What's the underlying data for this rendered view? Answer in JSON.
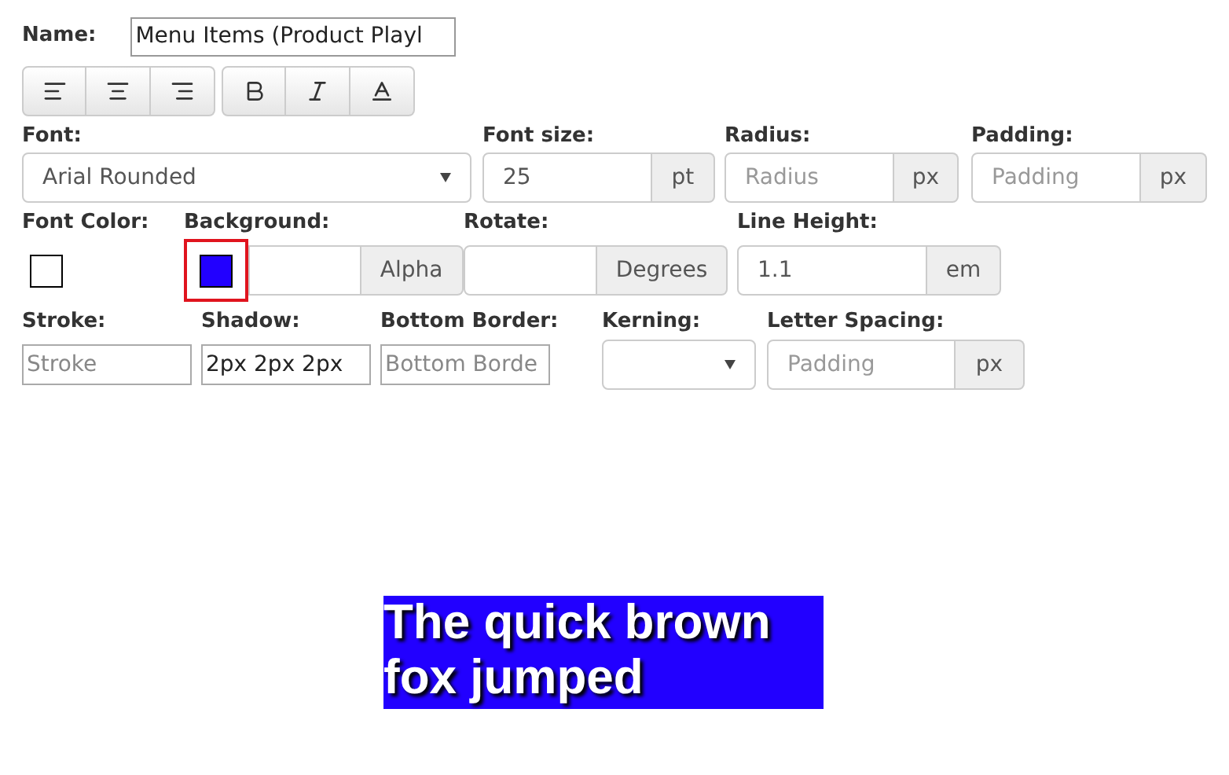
{
  "name": {
    "label": "Name:",
    "value": "Menu Items (Product Playl"
  },
  "rows": [
    [
      {
        "label": "Font:",
        "controls": [
          {
            "kind": "select",
            "value": "Arial Rounded"
          }
        ]
      },
      {
        "label": "Font size:",
        "controls": [
          {
            "kind": "input",
            "value": "25"
          },
          {
            "kind": "addon",
            "text": "pt"
          }
        ]
      },
      {
        "label": "Radius:",
        "controls": [
          {
            "kind": "input",
            "placeholder": "Radius"
          },
          {
            "kind": "addon",
            "text": "px"
          }
        ]
      },
      {
        "label": "Padding:",
        "controls": [
          {
            "kind": "input",
            "placeholder": "Padding"
          },
          {
            "kind": "addon",
            "text": "px"
          }
        ]
      }
    ],
    [
      {
        "label": "Font Color:",
        "controls": [
          {
            "kind": "color",
            "color": "#ffffff",
            "selected": false
          }
        ]
      },
      {
        "label": "Background:",
        "controls": [
          {
            "kind": "color",
            "color": "#2200ff",
            "selected": true
          },
          {
            "kind": "input"
          },
          {
            "kind": "addon",
            "text": "Alpha"
          }
        ]
      },
      {
        "label": "Rotate:",
        "controls": [
          {
            "kind": "input"
          },
          {
            "kind": "addon",
            "text": "Degrees"
          }
        ]
      },
      {
        "label": "Line Height:",
        "controls": [
          {
            "kind": "input",
            "value": "1.1"
          },
          {
            "kind": "addon",
            "text": "em"
          }
        ]
      }
    ],
    [
      {
        "label": "Stroke:",
        "controls": [
          {
            "kind": "plain",
            "placeholder": "Stroke"
          }
        ]
      },
      {
        "label": "Shadow:",
        "controls": [
          {
            "kind": "plain",
            "value": "2px 2px 2px"
          }
        ]
      },
      {
        "label": "Bottom Border:",
        "controls": [
          {
            "kind": "plain",
            "placeholder": "Bottom Borde"
          }
        ]
      },
      {
        "label": "Kerning:",
        "controls": [
          {
            "kind": "select"
          }
        ]
      },
      {
        "label": "Letter Spacing:",
        "controls": [
          {
            "kind": "input",
            "placeholder": "Padding"
          },
          {
            "kind": "addon",
            "text": "px"
          }
        ]
      }
    ]
  ],
  "preview": {
    "text": "The quick brown fox jumped"
  }
}
